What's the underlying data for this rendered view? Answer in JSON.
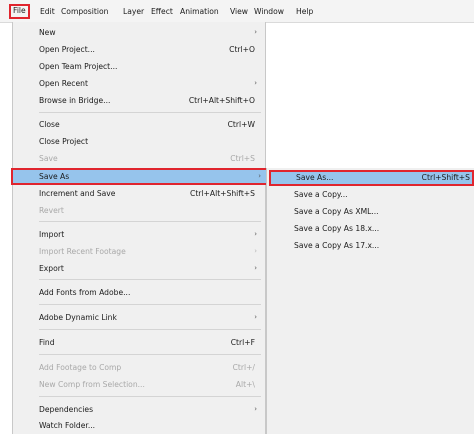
{
  "menubar": {
    "items": [
      "File",
      "Edit",
      "Composition",
      "Layer",
      "Effect",
      "Animation",
      "View",
      "Window",
      "Help"
    ],
    "active": "File"
  },
  "file_menu": {
    "items": [
      {
        "label": "New",
        "shortcut": "",
        "submenu": true,
        "disabled": false
      },
      {
        "label": "Open Project...",
        "shortcut": "Ctrl+O",
        "submenu": false,
        "disabled": false
      },
      {
        "label": "Open Team Project...",
        "shortcut": "",
        "submenu": false,
        "disabled": false
      },
      {
        "label": "Open Recent",
        "shortcut": "",
        "submenu": true,
        "disabled": false
      },
      {
        "label": "Browse in Bridge...",
        "shortcut": "Ctrl+Alt+Shift+O",
        "submenu": false,
        "disabled": false
      },
      {
        "label": "Close",
        "shortcut": "Ctrl+W",
        "submenu": false,
        "disabled": false
      },
      {
        "label": "Close Project",
        "shortcut": "",
        "submenu": false,
        "disabled": false
      },
      {
        "label": "Save",
        "shortcut": "Ctrl+S",
        "submenu": false,
        "disabled": true
      },
      {
        "label": "Save As",
        "shortcut": "",
        "submenu": true,
        "disabled": false,
        "selected": true
      },
      {
        "label": "Increment and Save",
        "shortcut": "Ctrl+Alt+Shift+S",
        "submenu": false,
        "disabled": false
      },
      {
        "label": "Revert",
        "shortcut": "",
        "submenu": false,
        "disabled": true
      },
      {
        "label": "Import",
        "shortcut": "",
        "submenu": true,
        "disabled": false
      },
      {
        "label": "Import Recent Footage",
        "shortcut": "",
        "submenu": true,
        "disabled": true
      },
      {
        "label": "Export",
        "shortcut": "",
        "submenu": true,
        "disabled": false
      },
      {
        "label": "Add Fonts from Adobe...",
        "shortcut": "",
        "submenu": false,
        "disabled": false
      },
      {
        "label": "Adobe Dynamic Link",
        "shortcut": "",
        "submenu": true,
        "disabled": false
      },
      {
        "label": "Find",
        "shortcut": "Ctrl+F",
        "submenu": false,
        "disabled": false
      },
      {
        "label": "Add Footage to Comp",
        "shortcut": "Ctrl+/",
        "submenu": false,
        "disabled": true
      },
      {
        "label": "New Comp from Selection...",
        "shortcut": "Alt+\\",
        "submenu": false,
        "disabled": true
      },
      {
        "label": "Dependencies",
        "shortcut": "",
        "submenu": true,
        "disabled": false
      },
      {
        "label": "Watch Folder...",
        "shortcut": "",
        "submenu": false,
        "disabled": false
      }
    ]
  },
  "save_as_submenu": {
    "items": [
      {
        "label": "Save As...",
        "shortcut": "Ctrl+Shift+S",
        "selected": true
      },
      {
        "label": "Save a Copy...",
        "shortcut": ""
      },
      {
        "label": "Save a Copy As XML...",
        "shortcut": ""
      },
      {
        "label": "Save a Copy As 18.x...",
        "shortcut": ""
      },
      {
        "label": "Save a Copy As 17.x...",
        "shortcut": ""
      }
    ]
  },
  "colors": {
    "highlight": "#96c4ec",
    "callout_border": "#e0252e",
    "menu_bg": "#f0f0f0",
    "disabled_text": "#a8a8a8"
  },
  "icons": {
    "submenu_arrow": "chevron-right-icon"
  }
}
